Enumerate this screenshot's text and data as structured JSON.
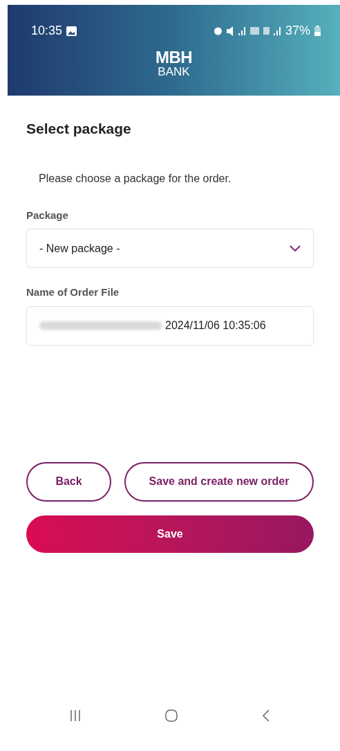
{
  "status_bar": {
    "time": "10:35",
    "battery": "37%"
  },
  "header": {
    "logo_top": "MBH",
    "logo_bottom": "BANK"
  },
  "title": "Select package",
  "description": "Please choose a package for the order.",
  "fields": [
    {
      "kind": "select",
      "label": "Package",
      "value": "- New package -"
    },
    {
      "kind": "text",
      "label": "Name of Order File",
      "value": "2024/11/06 10:35:06",
      "redacted_prefix": true
    }
  ],
  "buttons": [
    {
      "kind": "outline",
      "label": "Back"
    },
    {
      "kind": "outline",
      "label": "Save and create new order"
    },
    {
      "kind": "filled",
      "label": "Save"
    }
  ]
}
